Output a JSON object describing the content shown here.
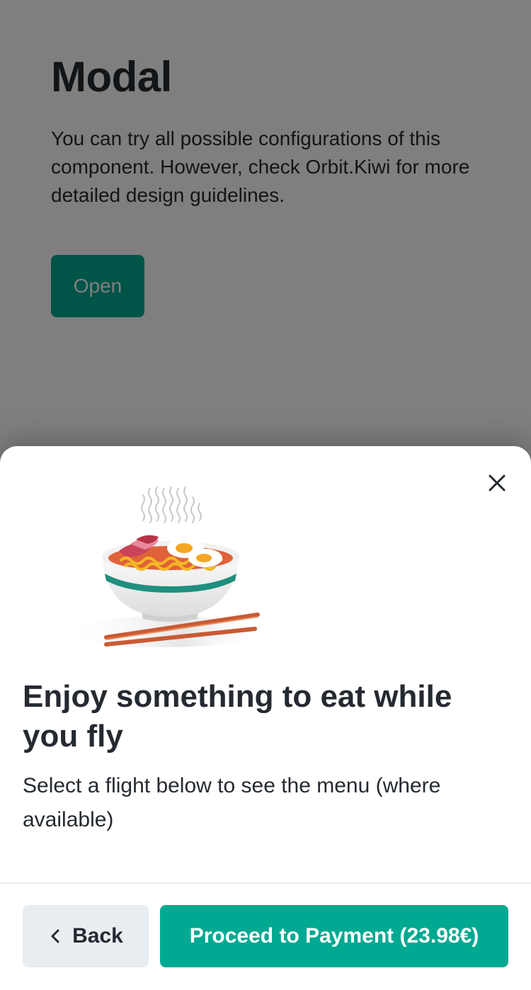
{
  "page": {
    "title": "Modal",
    "description": "You can try all possible configurations of this component. However, check Orbit.Kiwi for more detailed design guidelines.",
    "open_label": "Open"
  },
  "modal": {
    "close_icon": "close-icon",
    "illustration": "noodle-bowl-illustration",
    "title": "Enjoy something to eat while you fly",
    "description": "Select a flight below to see the menu (where available)",
    "back_label": "Back",
    "back_icon": "chevron-left-icon",
    "proceed_label": "Proceed to Payment (23.98€)"
  },
  "colors": {
    "primary": "#00a991",
    "text": "#252a31",
    "secondary_bg": "#e8edf1"
  }
}
